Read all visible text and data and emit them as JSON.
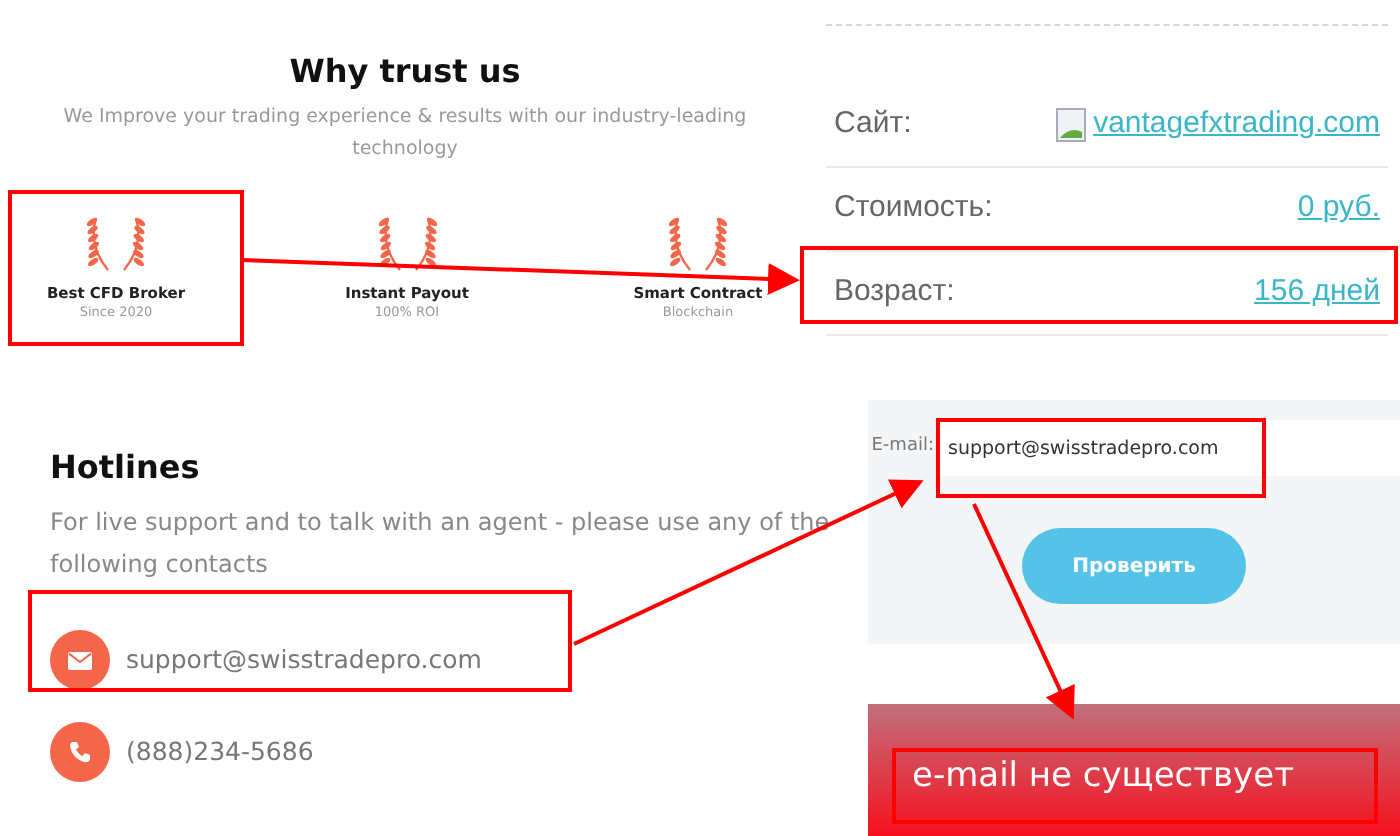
{
  "trust_section": {
    "title": "Why trust us",
    "subtitle": "We Improve your trading experience & results with our industry-leading technology",
    "awards": [
      {
        "title": "Best CFD Broker",
        "subtitle": "Since 2020"
      },
      {
        "title": "Instant Payout",
        "subtitle": "100% ROI"
      },
      {
        "title": "Smart Contract",
        "subtitle": "Blockchain"
      }
    ]
  },
  "site_info": {
    "rows": [
      {
        "label": "Сайт:",
        "value": "vantagefxtrading.com",
        "kind": "site"
      },
      {
        "label": "Стоимость:",
        "value": "0 руб.",
        "kind": "plain"
      },
      {
        "label": "Возраст:",
        "value": "156 дней",
        "kind": "plain"
      }
    ]
  },
  "hotlines": {
    "title": "Hotlines",
    "text": "For live support and to talk with an agent - please use any of the following contacts",
    "contacts": [
      {
        "kind": "email",
        "text": "support@swisstradepro.com"
      },
      {
        "kind": "phone",
        "text": "(888)234-5686"
      }
    ]
  },
  "email_check": {
    "label": "E-mail:",
    "value": "support@swisstradepro.com",
    "button": "Проверить",
    "result": "e-mail не существует"
  }
}
